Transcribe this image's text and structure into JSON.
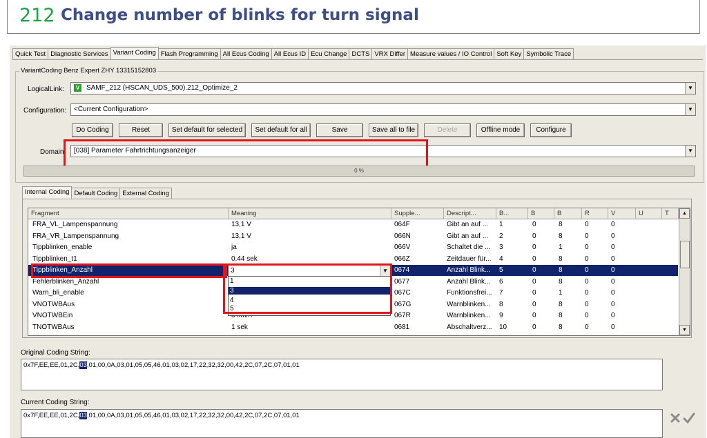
{
  "header": {
    "number": "212",
    "title": "Change number of blinks for turn signal"
  },
  "tabs": [
    "Quick Test",
    "Diagnostic Services",
    "Variant Coding",
    "Flash Programming",
    "All Ecus Coding",
    "All Ecus ID",
    "Ecu Change",
    "DCTS",
    "VRX Differ",
    "Measure values / IO Control",
    "Soft Key",
    "Symbolic Trace"
  ],
  "group_title": "VariantCoding Benz Expert ZHY 13315152803",
  "logical_link": {
    "label": "LogicalLink:",
    "badge": "V",
    "value": "SAMF_212 (HSCAN_UDS_500).212_Optimize_2"
  },
  "configuration": {
    "label": "Configuration:",
    "value": "<Current Configuration>"
  },
  "buttons": [
    "Do Coding",
    "Reset",
    "Set default for selected",
    "Set default for all",
    "Save",
    "Save all to file",
    "Delete",
    "Offline mode",
    "Configure"
  ],
  "domain": {
    "label": "Domain",
    "value": "[038] Parameter Fahrtrichtungsanzeiger"
  },
  "progress": "0 %",
  "subtabs": [
    "Internal Coding",
    "Default Coding",
    "External Coding"
  ],
  "grid": {
    "columns": [
      "Fragment",
      "Meaning",
      "Supple...",
      "Descript...",
      "B...",
      "B",
      "B",
      "R",
      "V",
      "U",
      "T"
    ],
    "rows": [
      [
        "FRA_VL_Lampenspannung",
        "13,1 V",
        "064F",
        "Gibt an auf ...",
        "1",
        "0",
        "8",
        "0",
        "0"
      ],
      [
        "FRA_VR_Lampenspannung",
        "13,1 V",
        "066N",
        "Gibt an auf ...",
        "2",
        "0",
        "8",
        "0",
        "0"
      ],
      [
        "Tippblinken_enable",
        "ja",
        "066V",
        "Schaltet die ...",
        "3",
        "0",
        "1",
        "0",
        "0"
      ],
      [
        "Tippblinken_t1",
        "0.44 sek",
        "066Z",
        "Zeitdauer für...",
        "4",
        "0",
        "8",
        "0",
        "0"
      ],
      [
        "Tippblinken_Anzahl",
        "3",
        "0674",
        "Anzahl Blink...",
        "5",
        "0",
        "8",
        "0",
        "0"
      ],
      [
        "Fehlerblinken_Anzahl",
        "",
        "0677",
        "Anzahl Blink...",
        "6",
        "0",
        "8",
        "0",
        "0"
      ],
      [
        "Warn_bli_enable",
        "",
        "067C",
        "Funktionsfrei...",
        "7",
        "0",
        "1",
        "0",
        "0"
      ],
      [
        "VNOTWBAus",
        "",
        "067G",
        "Warnblinken...",
        "8",
        "0",
        "8",
        "0",
        "0"
      ],
      [
        "VNOTWBEin",
        "3 km/h",
        "067R",
        "Warnblinken...",
        "9",
        "0",
        "8",
        "0",
        "0"
      ],
      [
        "TNOTWBAus",
        "1 sek",
        "0681",
        "Abschaltverz...",
        "10",
        "0",
        "8",
        "0",
        "0"
      ]
    ],
    "selected_row": 4
  },
  "dropdown": {
    "value": "3",
    "options": [
      "1",
      "3",
      "4",
      "5"
    ],
    "selected_index": 1
  },
  "original_coding": {
    "label": "Original Coding String:",
    "before": "0x7F,EE,EE,01,2C,",
    "highlight": "03",
    "after": ",01,00,0A,03,01,05,05,46,01,03,02,17,22,32,32,00,42,2C,07,2C,07,01,01"
  },
  "current_coding": {
    "label": "Current Coding String:",
    "before": "0x7F,EE,EE,01,2C,",
    "highlight": "03",
    "after": ",01,00,0A,03,01,05,05,46,01,03,02,17,22,32,32,00,42,2C,07,2C,07,01,01"
  },
  "icons": {
    "cancel": "x-icon",
    "confirm": "check-icon"
  },
  "colors": {
    "title_number": "#1da34a",
    "title_text": "#3d4f84",
    "highlight_red": "#e0161c",
    "selection": "#11246b"
  }
}
